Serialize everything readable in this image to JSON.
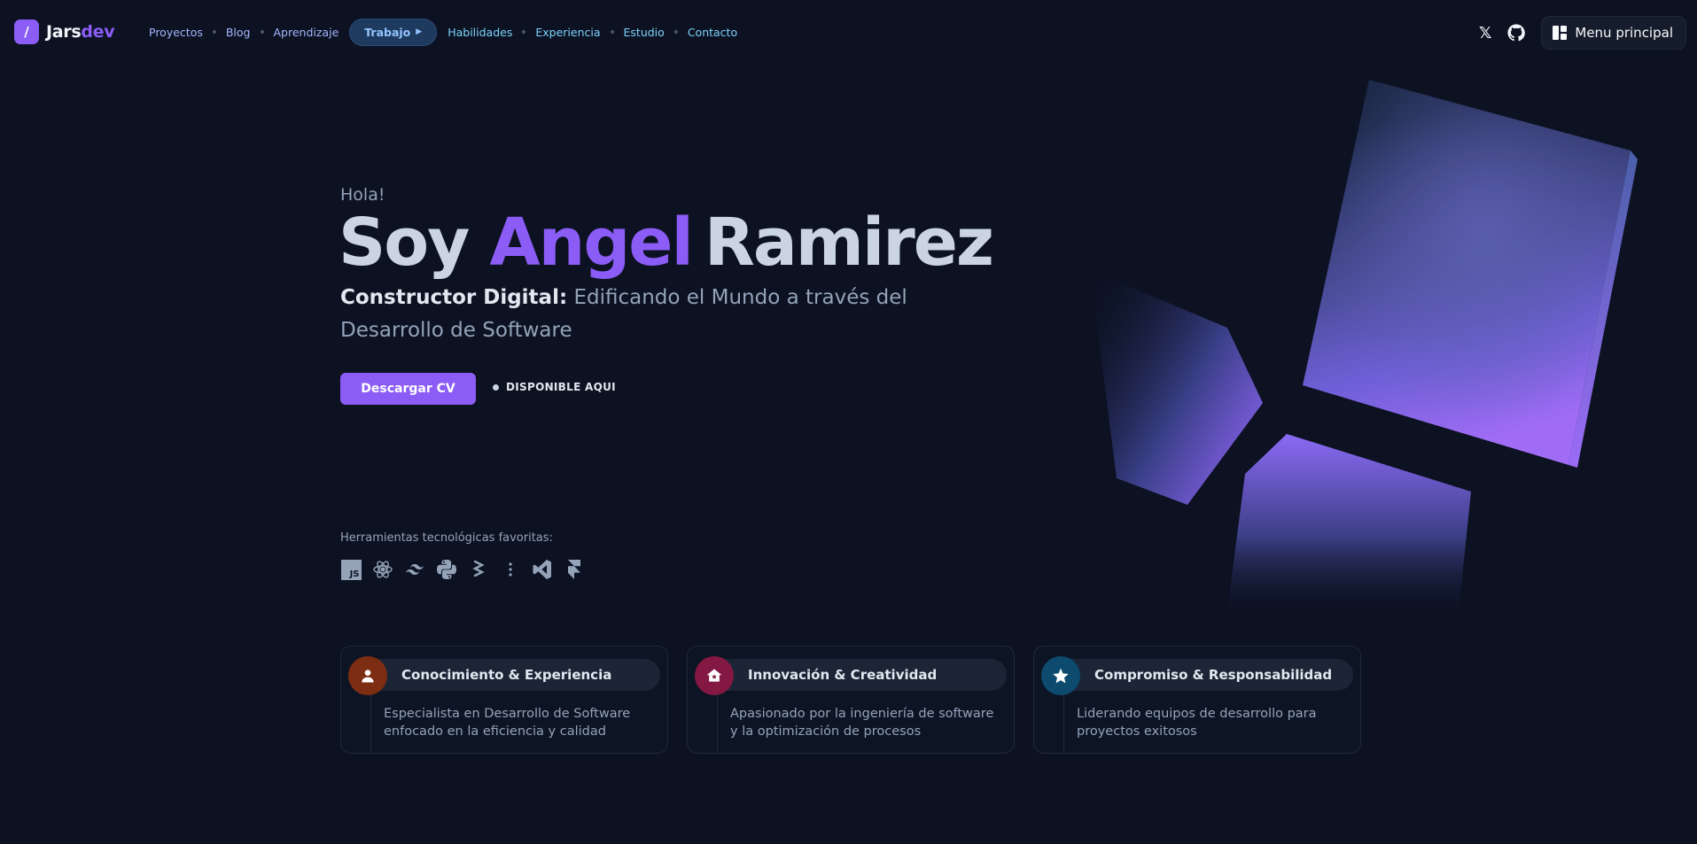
{
  "brand": {
    "badge": "/",
    "name_part1": "Jars",
    "name_part2": "dev"
  },
  "nav": {
    "items": [
      "Proyectos",
      "Blog",
      "Aprendizaje"
    ],
    "pill": {
      "label": "Trabajo",
      "icon": "play-icon"
    },
    "items_right": [
      "Habilidades",
      "Experiencia",
      "Estudio",
      "Contacto"
    ],
    "social": [
      "x-icon",
      "github-icon"
    ],
    "main_menu": "Menu principal"
  },
  "hero": {
    "greeting": "Hola!",
    "title_prefix": "Soy",
    "first_name": "Angel",
    "last_name": "Ramirez",
    "subtitle_strong": "Constructor Digital:",
    "subtitle_rest": " Edificando el Mundo a través del Desarrollo de Software",
    "cv_button": "Descargar CV",
    "availability": "DISPONIBLE AQUI"
  },
  "tools": {
    "label": "Herramientas tecnológicas favoritas:",
    "icons": [
      "javascript-icon",
      "react-icon",
      "tailwind-icon",
      "python-icon",
      "git-icon",
      "more-icon",
      "vscode-icon",
      "framer-icon"
    ],
    "js_text": "JS"
  },
  "cards": [
    {
      "title": "Conocimiento & Experiencia",
      "desc": "Especialista en Desarrollo de Software enfocado en la eficiencia y calidad",
      "icon": "user-icon",
      "color": "#7c2d12"
    },
    {
      "title": "Innovación & Creatividad",
      "desc": "Apasionado por la ingeniería de software y la optimización de procesos",
      "icon": "home-icon",
      "color": "#831843"
    },
    {
      "title": "Compromiso & Responsabilidad",
      "desc": "Liderando equipos de desarrollo para proyectos exitosos",
      "icon": "star-icon",
      "color": "#0c4a6e"
    }
  ],
  "colors": {
    "accent": "#8b5cf6",
    "background": "#0c1222",
    "text_muted": "#94a3b8"
  }
}
